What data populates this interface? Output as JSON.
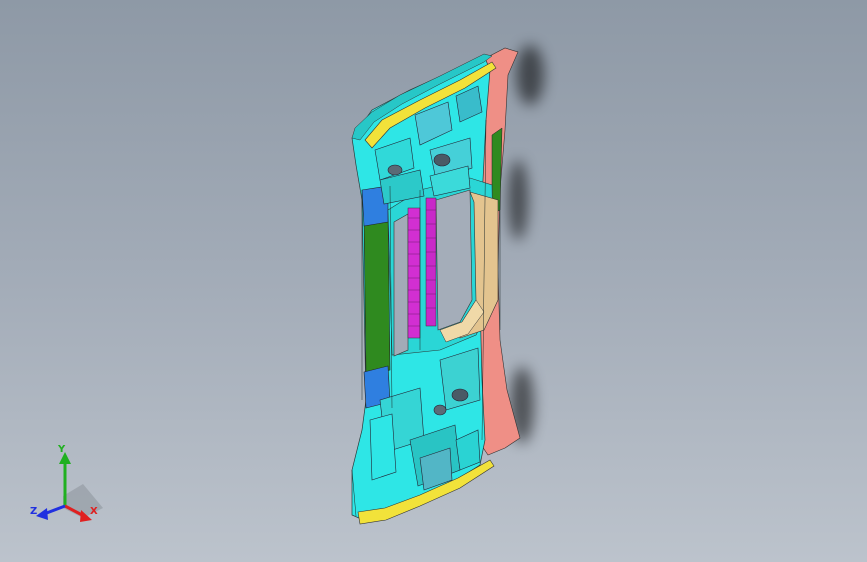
{
  "triad": {
    "x_label": "X",
    "y_label": "Y",
    "z_label": "Z",
    "x_color": "#e02020",
    "y_color": "#20b020",
    "z_color": "#2030e0"
  },
  "colors": {
    "background_top": "#8e99a6",
    "background_bottom": "#bcc3cc",
    "part_cyan": "#2ee6e6",
    "part_yellow": "#f2e23a",
    "part_salmon": "#ef8f86",
    "part_green": "#2f8a1f",
    "part_blue": "#2f7fe0",
    "part_tan": "#e3c48f",
    "part_magenta": "#d22fd2"
  }
}
